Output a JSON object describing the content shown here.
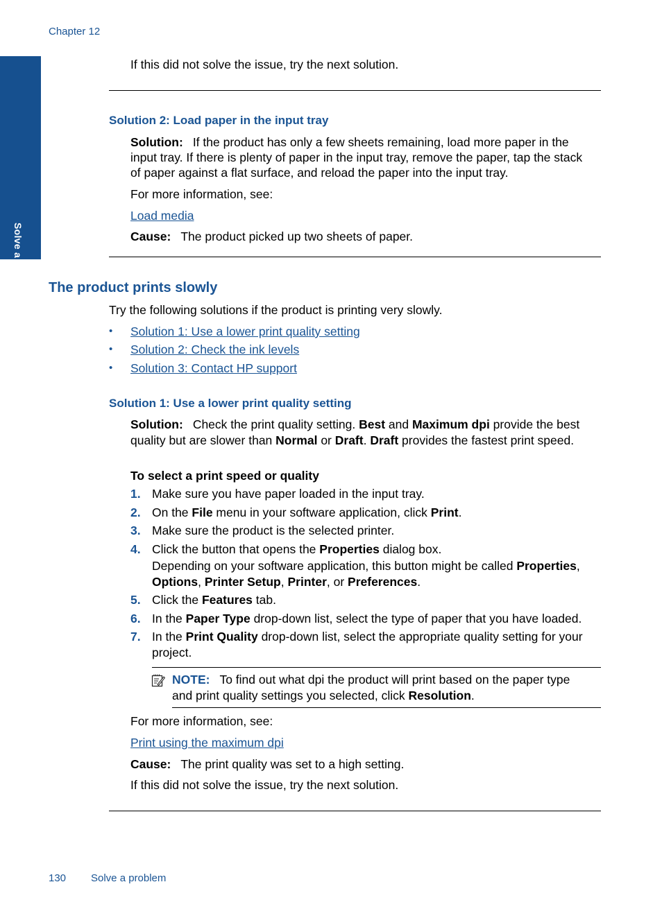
{
  "header": {
    "chapter": "Chapter 12"
  },
  "side_tab": {
    "label": "Solve a problem"
  },
  "intro_line": "If this did not solve the issue, try the next solution.",
  "solution2_section": {
    "heading": "Solution 2: Load paper in the input tray",
    "solution_label": "Solution:",
    "solution_lines": [
      "If the product has only a few sheets remaining, load more paper in the",
      "input tray. If there is plenty of paper in the input tray, remove the paper, tap the stack",
      "of paper against a flat surface, and reload the paper into the input tray."
    ],
    "more_info": "For more information, see:",
    "link": "Load media",
    "cause_label": "Cause:",
    "cause_text": "The product picked up two sheets of paper."
  },
  "slow_section": {
    "heading": "The product prints slowly",
    "intro": "Try the following solutions if the product is printing very slowly.",
    "bullet_char": "•",
    "links": [
      "Solution 1: Use a lower print quality setting",
      "Solution 2: Check the ink levels",
      "Solution 3: Contact HP support"
    ]
  },
  "solution1_section": {
    "heading": "Solution 1: Use a lower print quality setting",
    "solution_label": "Solution:",
    "line1": {
      "a": "Check the print quality setting. ",
      "b1": "Best",
      "c": " and ",
      "b2": "Maximum dpi",
      "d": " provide the best"
    },
    "line2": {
      "a": "quality but are slower than ",
      "b1": "Normal",
      "c": " or ",
      "b2": "Draft",
      "d": ". ",
      "b3": "Draft",
      "e": " provides the fastest print speed."
    },
    "procedure_title": "To select a print speed or quality",
    "steps": [
      {
        "n": "1.",
        "text": "Make sure you have paper loaded in the input tray."
      },
      {
        "n": "2.",
        "a": "On the ",
        "b1": "File",
        "c": " menu in your software application, click ",
        "b2": "Print",
        "d": "."
      },
      {
        "n": "3.",
        "text": "Make sure the product is the selected printer."
      },
      {
        "n": "4.",
        "a": "Click the button that opens the ",
        "b1": "Properties",
        "c": " dialog box.",
        "sub1a": "Depending on your software application, this button might be called ",
        "sub1b": "Properties",
        "sub1c": ",",
        "sub2": [
          "Options",
          ", ",
          "Printer Setup",
          ", ",
          "Printer",
          ", or ",
          "Preferences",
          "."
        ]
      },
      {
        "n": "5.",
        "a": "Click the ",
        "b1": "Features",
        "c": " tab."
      },
      {
        "n": "6.",
        "a": "In the ",
        "b1": "Paper Type",
        "c": " drop-down list, select the type of paper that you have loaded."
      },
      {
        "n": "7.",
        "a": "In the ",
        "b1": "Print Quality",
        "c": " drop-down list, select the appropriate quality setting for your",
        "line2": "project."
      }
    ],
    "note": {
      "icon": "note-pencil-icon",
      "label": "NOTE:",
      "line1": "To find out what dpi the product will print based on the paper type",
      "line2a": "and print quality settings you selected, click ",
      "line2b": "Resolution",
      "line2c": "."
    },
    "more_info": "For more information, see:",
    "link": "Print using the maximum dpi",
    "cause_label": "Cause:",
    "cause_text": "The print quality was set to a high setting.",
    "next": "If this did not solve the issue, try the next solution."
  },
  "footer": {
    "page_number": "130",
    "section": "Solve a problem"
  },
  "colors": {
    "accent": "#1a5494",
    "side_tab": "#16508f"
  }
}
